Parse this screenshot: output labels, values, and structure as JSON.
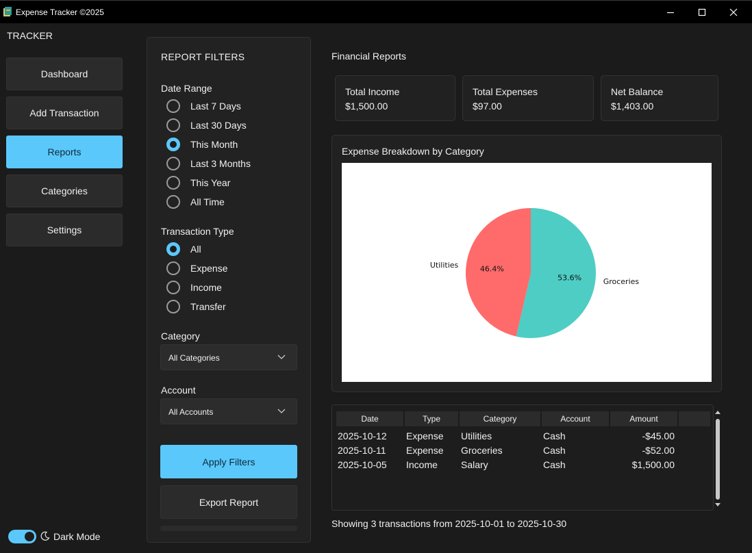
{
  "window": {
    "title": "Expense Tracker ©2025"
  },
  "sidebar": {
    "brand": "TRACKER",
    "items": [
      {
        "label": "Dashboard",
        "active": false
      },
      {
        "label": "Add Transaction",
        "active": false
      },
      {
        "label": "Reports",
        "active": true
      },
      {
        "label": "Categories",
        "active": false
      },
      {
        "label": "Settings",
        "active": false
      }
    ],
    "dark_mode": {
      "label": "Dark Mode",
      "enabled": true
    }
  },
  "filters": {
    "title": "REPORT FILTERS",
    "date_range": {
      "label": "Date Range",
      "options": [
        "Last 7 Days",
        "Last 30 Days",
        "This Month",
        "Last 3 Months",
        "This Year",
        "All Time"
      ],
      "selected": "This Month"
    },
    "transaction_type": {
      "label": "Transaction Type",
      "options": [
        "All",
        "Expense",
        "Income",
        "Transfer"
      ],
      "selected": "All"
    },
    "category": {
      "label": "Category",
      "value": "All Categories"
    },
    "account": {
      "label": "Account",
      "value": "All Accounts"
    },
    "apply_label": "Apply Filters",
    "export_label": "Export Report"
  },
  "main": {
    "title": "Financial Reports",
    "cards": [
      {
        "label": "Total Income",
        "value": "$1,500.00"
      },
      {
        "label": "Total Expenses",
        "value": "$97.00"
      },
      {
        "label": "Net Balance",
        "value": "$1,403.00"
      }
    ],
    "chart_title": "Expense Breakdown by Category",
    "table": {
      "headers": [
        "Date",
        "Type",
        "Category",
        "Account",
        "Amount"
      ],
      "rows": [
        [
          "2025-10-12",
          "Expense",
          "Utilities",
          "Cash",
          "-$45.00"
        ],
        [
          "2025-10-11",
          "Expense",
          "Groceries",
          "Cash",
          "-$52.00"
        ],
        [
          "2025-10-05",
          "Income",
          "Salary",
          "Cash",
          "$1,500.00"
        ]
      ]
    },
    "status": "Showing 3 transactions from 2025-10-01 to 2025-10-30"
  },
  "colors": {
    "accent": "#5bc8fb",
    "groceries": "#4ecdc4",
    "utilities": "#ff6b6b"
  },
  "chart_data": {
    "type": "pie",
    "title": "Expense Breakdown by Category",
    "categories": [
      "Groceries",
      "Utilities"
    ],
    "values": [
      52,
      45
    ],
    "percent_labels": [
      "53.6%",
      "46.4%"
    ],
    "colors": [
      "#4ecdc4",
      "#ff6b6b"
    ]
  }
}
